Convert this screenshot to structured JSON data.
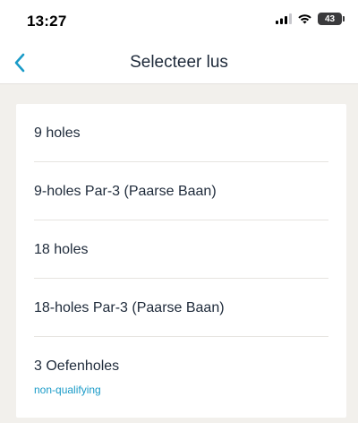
{
  "status_bar": {
    "time": "13:27",
    "battery": "43",
    "icons": [
      "signal-icon",
      "wifi-icon",
      "battery-icon"
    ]
  },
  "nav": {
    "title": "Selecteer lus",
    "back_icon": "chevron-left-icon"
  },
  "loops": [
    {
      "label": "9 holes"
    },
    {
      "label": "9-holes Par-3 (Paarse Baan)"
    },
    {
      "label": "18 holes"
    },
    {
      "label": "18-holes Par-3 (Paarse Baan)"
    },
    {
      "label": "3 Oefenholes",
      "sublabel": "non-qualifying"
    }
  ],
  "colors": {
    "accent": "#1a9bc8",
    "text": "#1e2a3a",
    "background": "#f2f0ec"
  }
}
